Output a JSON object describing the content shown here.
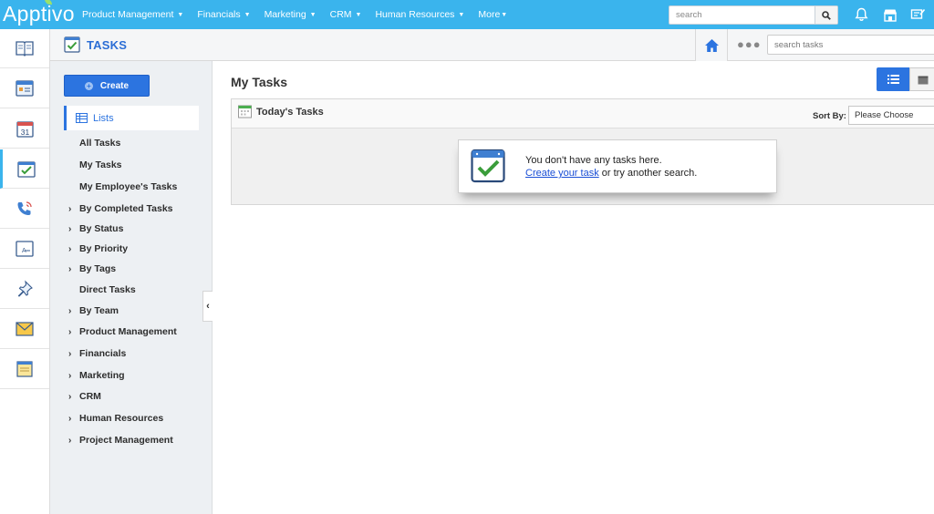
{
  "brand": {
    "logo_text": "Apptivo"
  },
  "nav": [
    {
      "label": "Product Management"
    },
    {
      "label": "Financials"
    },
    {
      "label": "Marketing"
    },
    {
      "label": "CRM"
    },
    {
      "label": "Human Resources"
    },
    {
      "label": "More"
    }
  ],
  "global_search": {
    "placeholder": "search"
  },
  "app": {
    "title": "TASKS",
    "search_placeholder": "search tasks"
  },
  "side": {
    "create_label": "Create",
    "lists_label": "Lists",
    "items": [
      {
        "label": "All Tasks"
      },
      {
        "label": "My Tasks"
      },
      {
        "label": "My Employee's Tasks"
      },
      {
        "label": "By Completed Tasks"
      },
      {
        "label": "By Status"
      },
      {
        "label": "By Priority"
      },
      {
        "label": "By Tags"
      },
      {
        "label": "Direct Tasks"
      },
      {
        "label": "By Team"
      },
      {
        "label": "Product Management"
      },
      {
        "label": "Financials"
      },
      {
        "label": "Marketing"
      },
      {
        "label": "CRM"
      },
      {
        "label": "Human Resources"
      },
      {
        "label": "Project Management"
      }
    ]
  },
  "main": {
    "title": "My Tasks",
    "panel_title": "Today's Tasks",
    "sort_label": "Sort By:",
    "sort_value": "Please Choose",
    "empty_line1": "You don't have any tasks here.",
    "empty_link": "Create your task",
    "empty_rest": " or try another search."
  },
  "colors": {
    "topbar": "#3ab4ed",
    "accent": "#2c74e0"
  }
}
